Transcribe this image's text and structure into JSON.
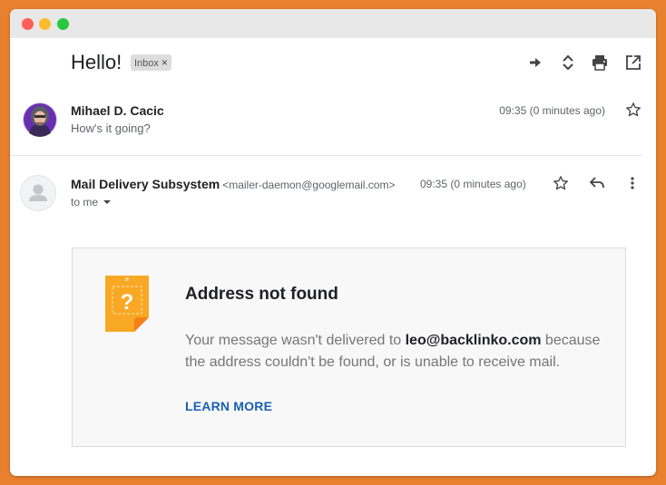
{
  "thread": {
    "subject": "Hello!",
    "label": "Inbox",
    "label_close": "×"
  },
  "toolbar_icons": [
    "forward-arrow-icon",
    "expand-collapse-icon",
    "print-icon",
    "open-in-new-window-icon"
  ],
  "message1": {
    "sender": "Mihael D. Cacic",
    "snippet": "How's it going?",
    "time": "09:35 (0 minutes ago)"
  },
  "message2": {
    "sender": "Mail Delivery Subsystem",
    "sender_address": "<mailer-daemon@googlemail.com>",
    "time": "09:35 (0 minutes ago)",
    "recipient": "to me"
  },
  "bounce": {
    "title": "Address not found",
    "text_before": "Your message wasn't delivered to ",
    "address": "leo@backlinko.com",
    "text_after": " because the address couldn't be found, or is unable to receive mail.",
    "link": "LEARN MORE",
    "icon_glyph": "?"
  },
  "colors": {
    "background": "#e8812e",
    "link": "#1a5fb4",
    "warning_icon": "#f9a825"
  }
}
